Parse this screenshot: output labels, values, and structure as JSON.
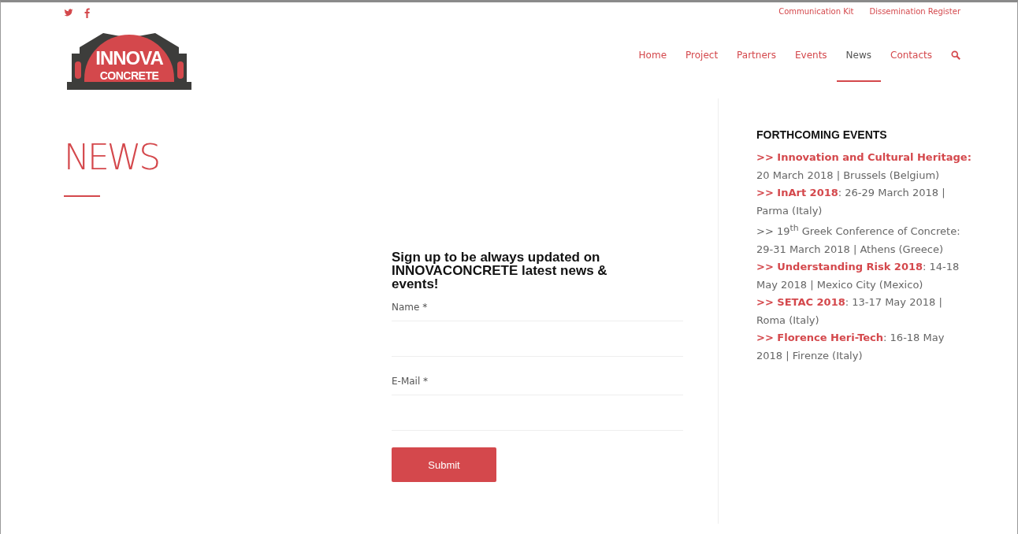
{
  "social": [
    {
      "kind": "twitter"
    },
    {
      "kind": "facebook"
    }
  ],
  "top_links": [
    "Communication Kit",
    "Dissemination Register"
  ],
  "logo": {
    "line_1": "INNOVA",
    "line_2": "CONCRETE"
  },
  "nav": [
    {
      "label": "Home",
      "selected": false
    },
    {
      "label": "Project",
      "selected": false
    },
    {
      "label": "Partners",
      "selected": false
    },
    {
      "label": "Events",
      "selected": false
    },
    {
      "label": "News",
      "selected": true
    },
    {
      "label": "Contacts",
      "selected": false
    }
  ],
  "page_title": "NEWS",
  "signup": {
    "heading": "Sign up to be always updated on INNOVACONCRETE latest news & events!",
    "fields": [
      {
        "label": "Name *"
      },
      {
        "label": "E-Mail *"
      }
    ],
    "button": "Submit"
  },
  "sidebar": {
    "heading": "FORTHCOMING EVENTS",
    "events": [
      {
        "link": ">> Innovation and Cultural Heritage:",
        "text": " 20 March 2018 | Brussels (Belgium)"
      },
      {
        "link": ">> InArt 2018",
        "text": ": 26-29 March 2018 | Parma (Italy)"
      },
      {
        "text": ">> 19$^{th}$ Greek Conference of Concrete: 29-31 March 2018 | Athens (Greece)"
      },
      {
        "link": ">> Understanding Risk 2018",
        "text": ": 14-18 May 2018 | Mexico City (Mexico)"
      },
      {
        "link": ">> SETAC 2018",
        "text": ": 13-17 May 2018 | Roma (Italy)"
      },
      {
        "link": ">> Florence Heri-Tech",
        "text": ": 16-18 May 2018 | Firenze (Italy)"
      }
    ]
  }
}
